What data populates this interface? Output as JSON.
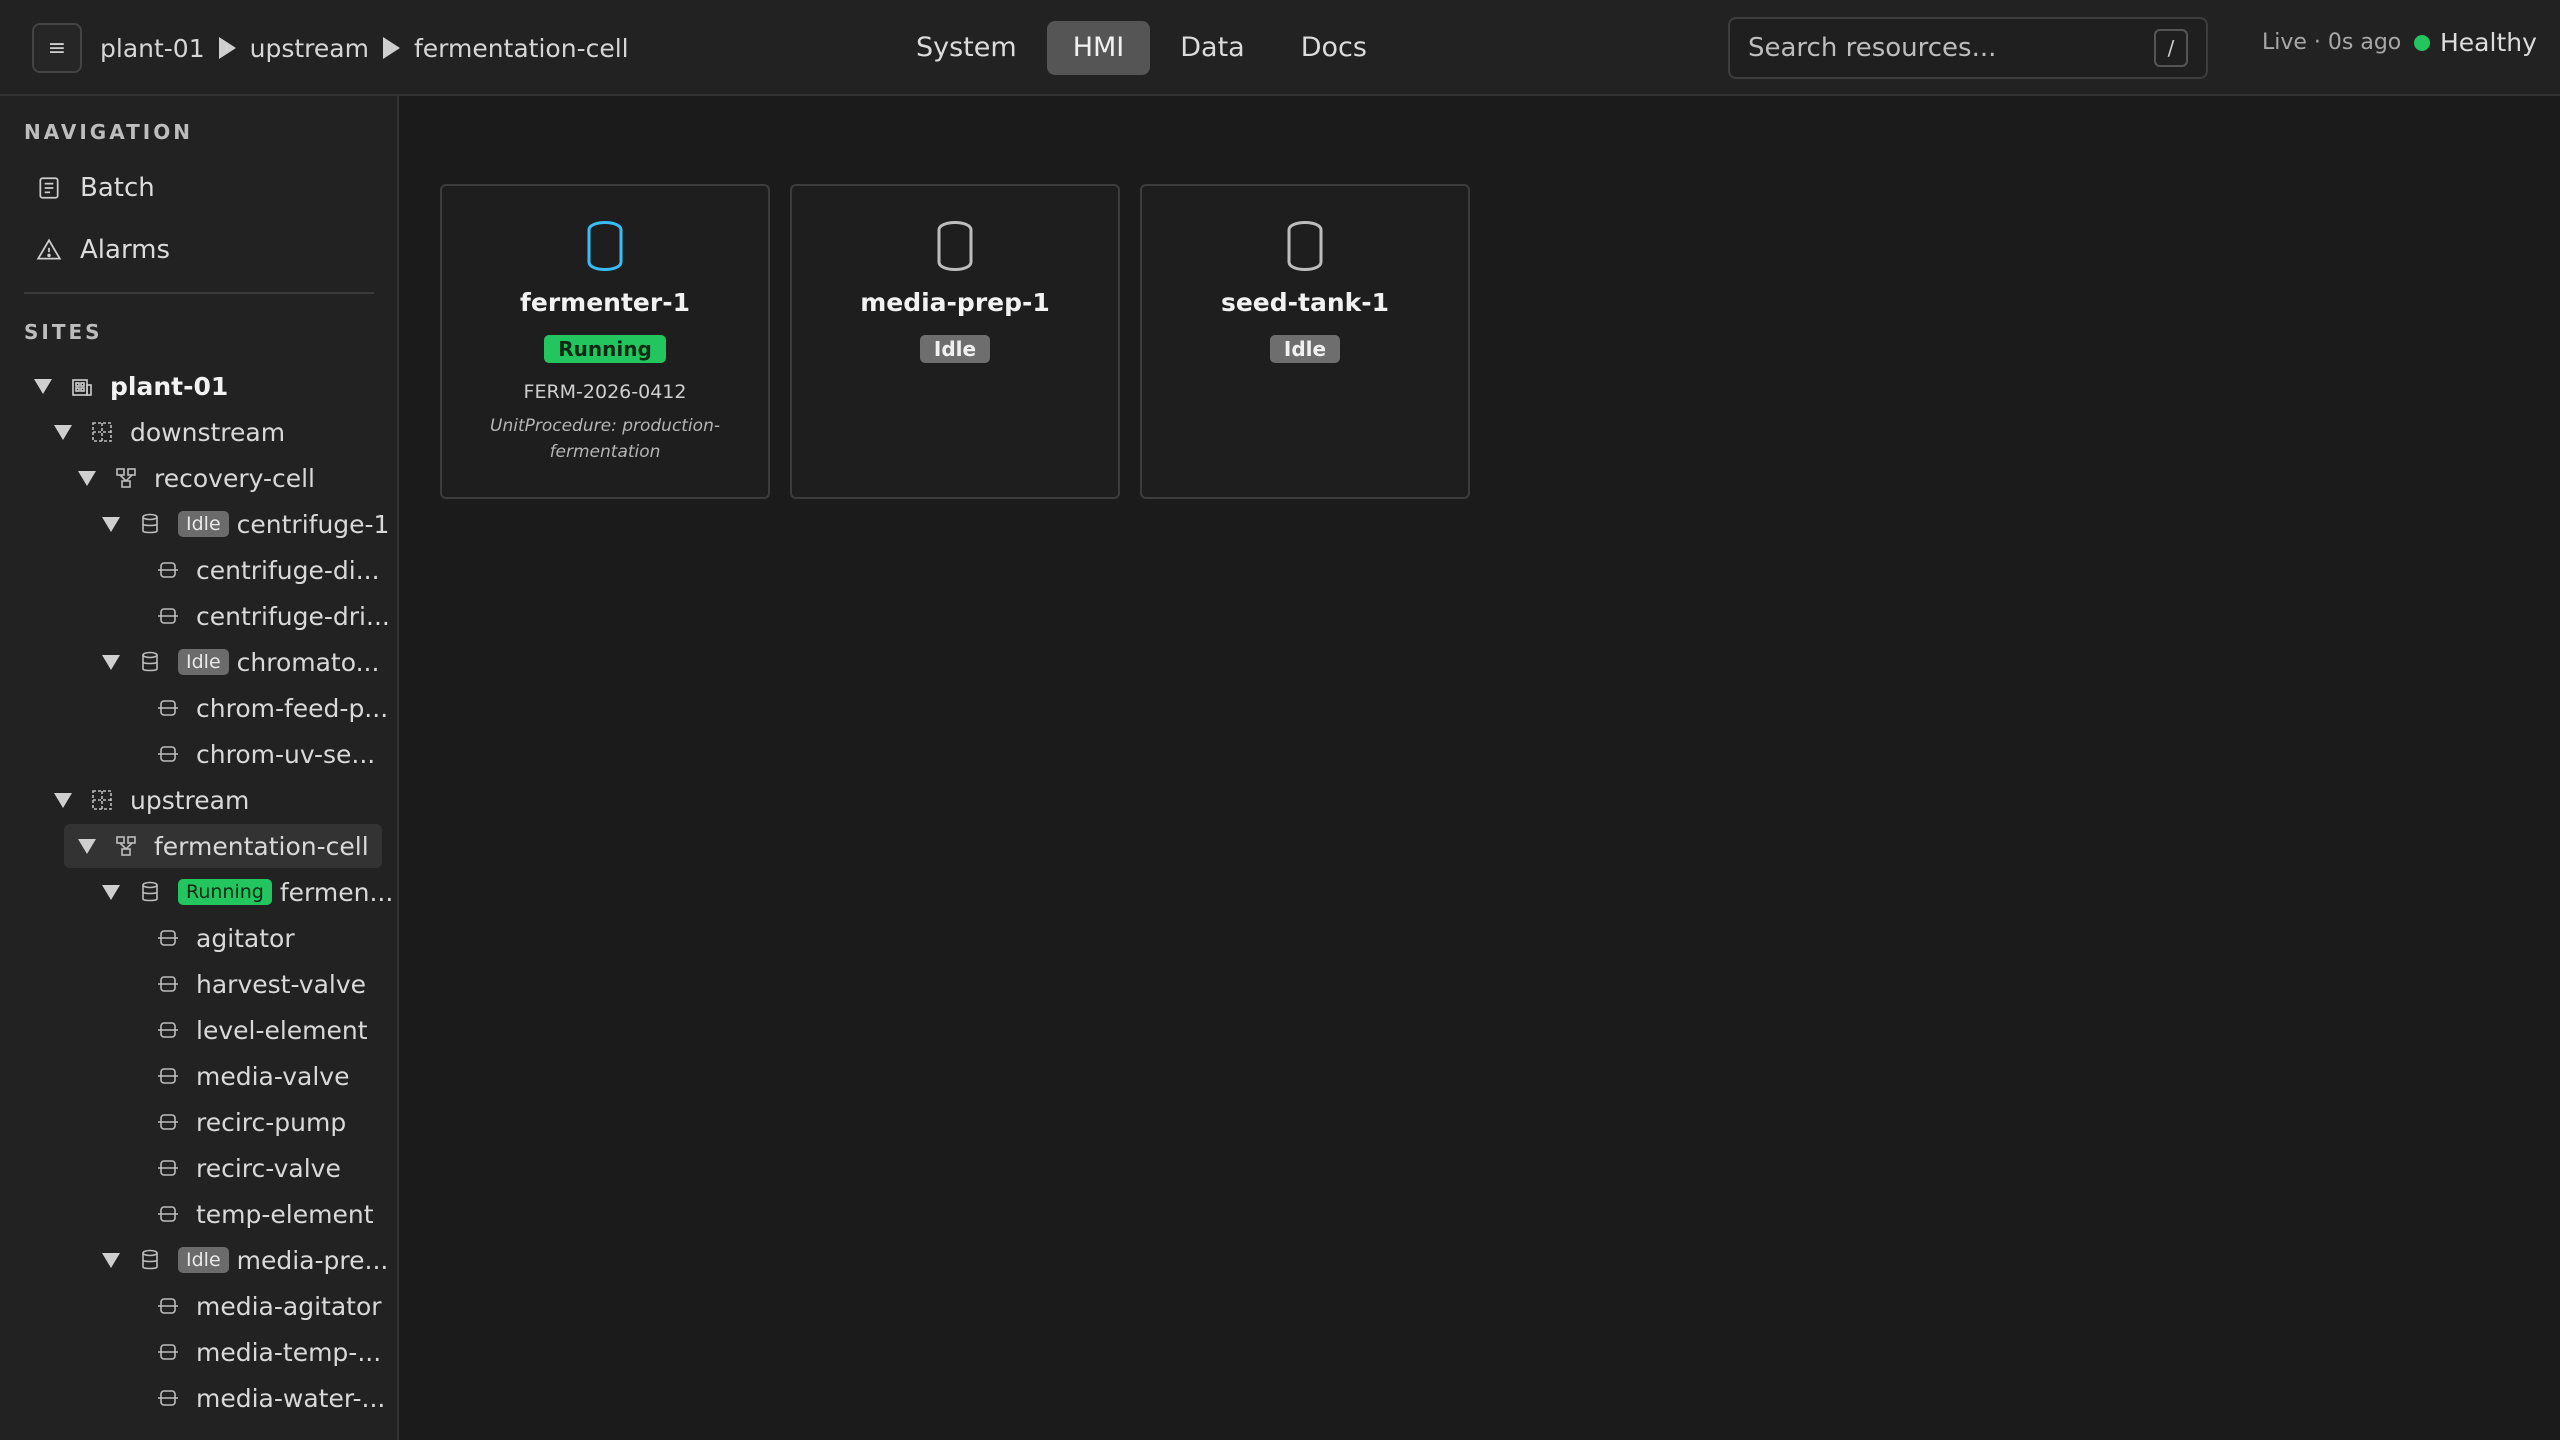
{
  "header": {
    "menu_icon": "hamburger-icon",
    "breadcrumb": [
      "plant-01",
      "upstream",
      "fermentation-cell"
    ],
    "tabs": [
      {
        "label": "System",
        "active": false
      },
      {
        "label": "HMI",
        "active": true
      },
      {
        "label": "Data",
        "active": false
      },
      {
        "label": "Docs",
        "active": false
      }
    ],
    "search": {
      "placeholder": "Search resources...",
      "shortcut": "/"
    },
    "live": "Live · 0s ago",
    "health": "Healthy",
    "health_color": "#22c55e"
  },
  "sidebar": {
    "nav_title": "NAVIGATION",
    "nav_items": [
      {
        "label": "Batch",
        "icon": "batch-icon"
      },
      {
        "label": "Alarms",
        "icon": "alarm-icon"
      }
    ],
    "sites_title": "SITES",
    "tree": [
      {
        "label": "plant-01",
        "icon": "site-icon",
        "badge": null
      },
      {
        "label": "downstream",
        "icon": "area-icon",
        "badge": null
      },
      {
        "label": "recovery-cell",
        "icon": "cell-icon",
        "badge": null
      },
      {
        "label": "centrifuge-1",
        "icon": "unit-icon",
        "badge": "Idle"
      },
      {
        "label": "centrifuge-di...",
        "icon": "equipment-icon",
        "badge": null
      },
      {
        "label": "centrifuge-dri...",
        "icon": "equipment-icon",
        "badge": null
      },
      {
        "label": "chromato...",
        "icon": "unit-icon",
        "badge": "Idle"
      },
      {
        "label": "chrom-feed-p...",
        "icon": "equipment-icon",
        "badge": null
      },
      {
        "label": "chrom-uv-se...",
        "icon": "equipment-icon",
        "badge": null
      },
      {
        "label": "upstream",
        "icon": "area-icon",
        "badge": null
      },
      {
        "label": "fermentation-cell",
        "icon": "cell-icon",
        "badge": null
      },
      {
        "label": "fermen...",
        "icon": "unit-icon",
        "badge": "Running"
      },
      {
        "label": "agitator",
        "icon": "equipment-icon",
        "badge": null
      },
      {
        "label": "harvest-valve",
        "icon": "equipment-icon",
        "badge": null
      },
      {
        "label": "level-element",
        "icon": "equipment-icon",
        "badge": null
      },
      {
        "label": "media-valve",
        "icon": "equipment-icon",
        "badge": null
      },
      {
        "label": "recirc-pump",
        "icon": "equipment-icon",
        "badge": null
      },
      {
        "label": "recirc-valve",
        "icon": "equipment-icon",
        "badge": null
      },
      {
        "label": "temp-element",
        "icon": "equipment-icon",
        "badge": null
      },
      {
        "label": "media-pre...",
        "icon": "unit-icon",
        "badge": "Idle"
      },
      {
        "label": "media-agitator",
        "icon": "equipment-icon",
        "badge": null
      },
      {
        "label": "media-temp-...",
        "icon": "equipment-icon",
        "badge": null
      },
      {
        "label": "media-water-...",
        "icon": "equipment-icon",
        "badge": null
      }
    ]
  },
  "cards": [
    {
      "name": "fermenter-1",
      "status": "Running",
      "batch": "FERM-2026-0412",
      "procedure": "UnitProcedure: production-fermentation",
      "icon": "vessel-icon",
      "icon_color": "#38bdf8"
    },
    {
      "name": "media-prep-1",
      "status": "Idle",
      "batch": "",
      "procedure": "",
      "icon": "vessel-icon",
      "icon_color": "#bdbdbd"
    },
    {
      "name": "seed-tank-1",
      "status": "Idle",
      "batch": "",
      "procedure": "",
      "icon": "vessel-icon",
      "icon_color": "#bdbdbd"
    }
  ]
}
